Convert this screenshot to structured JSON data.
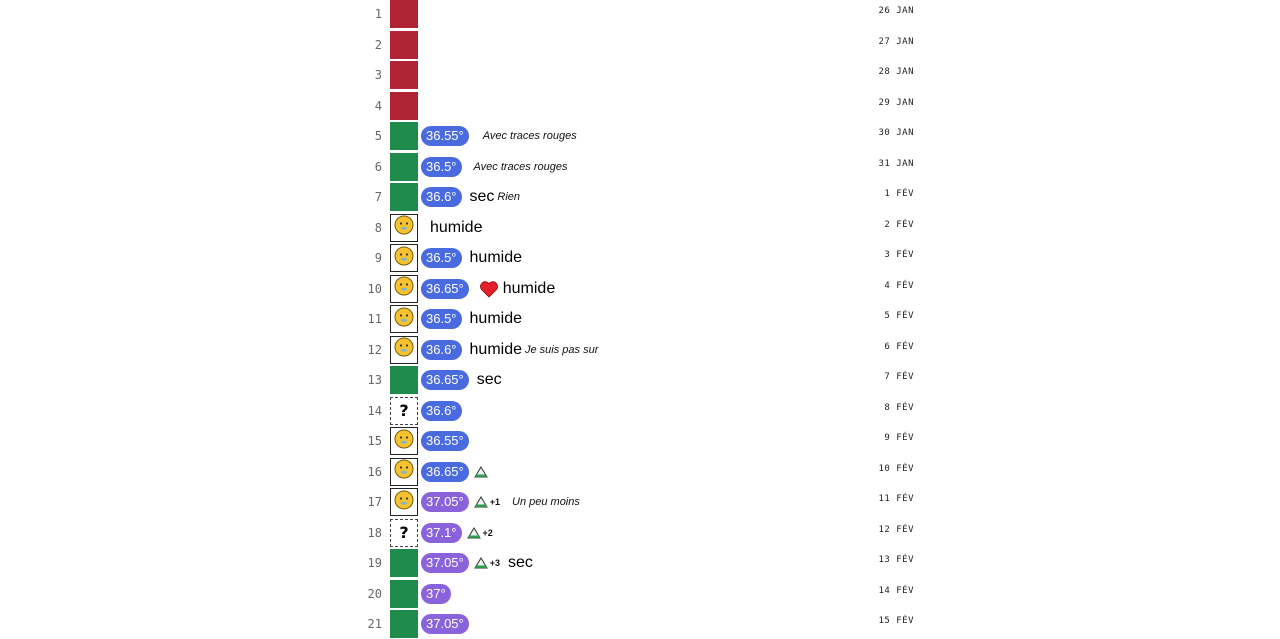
{
  "colors": {
    "period": "#b02436",
    "dry": "#1e8a4c",
    "temp_normal": "#4a6be0",
    "temp_high": "#8a63dc"
  },
  "rows": [
    {
      "num": "1",
      "box": "red",
      "date": "26 JAN"
    },
    {
      "num": "2",
      "box": "red",
      "date": "27 JAN"
    },
    {
      "num": "3",
      "box": "red",
      "date": "28 JAN"
    },
    {
      "num": "4",
      "box": "red",
      "date": "29 JAN"
    },
    {
      "num": "5",
      "box": "green",
      "temp": "36.55°",
      "temp_level": "normal",
      "note": "Avec traces rouges",
      "date": "30 JAN"
    },
    {
      "num": "6",
      "box": "green",
      "temp": "36.5°",
      "temp_level": "normal",
      "note": "Avec traces rouges",
      "date": "31 JAN"
    },
    {
      "num": "7",
      "box": "green",
      "temp": "36.6°",
      "temp_level": "normal",
      "obs": "sec",
      "note": "Rien",
      "date": "1 FÉV"
    },
    {
      "num": "8",
      "box": "face",
      "obs": "humide",
      "date": "2 FÉV"
    },
    {
      "num": "9",
      "box": "face",
      "temp": "36.5°",
      "temp_level": "normal",
      "obs": "humide",
      "date": "3 FÉV"
    },
    {
      "num": "10",
      "box": "face",
      "temp": "36.65°",
      "temp_level": "normal",
      "heart": true,
      "obs": "humide",
      "date": "4 FÉV"
    },
    {
      "num": "11",
      "box": "face",
      "temp": "36.5°",
      "temp_level": "normal",
      "obs": "humide",
      "date": "5 FÉV"
    },
    {
      "num": "12",
      "box": "face",
      "temp": "36.6°",
      "temp_level": "normal",
      "obs": "humide",
      "note": "Je suis pas sur",
      "date": "6 FÉV"
    },
    {
      "num": "13",
      "box": "green",
      "temp": "36.65°",
      "temp_level": "normal",
      "obs": "sec",
      "date": "7 FÉV"
    },
    {
      "num": "14",
      "box": "unknown",
      "box_text": "?",
      "temp": "36.6°",
      "temp_level": "normal",
      "date": "8 FÉV"
    },
    {
      "num": "15",
      "box": "face",
      "temp": "36.55°",
      "temp_level": "normal",
      "date": "9 FÉV"
    },
    {
      "num": "16",
      "box": "face",
      "temp": "36.65°",
      "temp_level": "normal",
      "peak": "",
      "date": "10 FÉV"
    },
    {
      "num": "17",
      "box": "face",
      "temp": "37.05°",
      "temp_level": "high",
      "peak": "+1",
      "note": "Un peu moins",
      "date": "11 FÉV"
    },
    {
      "num": "18",
      "box": "unknown",
      "box_text": "?",
      "temp": "37.1°",
      "temp_level": "high",
      "peak": "+2",
      "date": "12 FÉV"
    },
    {
      "num": "19",
      "box": "green",
      "temp": "37.05°",
      "temp_level": "high",
      "peak": "+3",
      "obs": "sec",
      "date": "13 FÉV"
    },
    {
      "num": "20",
      "box": "green",
      "temp": "37°",
      "temp_level": "high",
      "date": "14 FÉV"
    },
    {
      "num": "21",
      "box": "green",
      "temp": "37.05°",
      "temp_level": "high",
      "date": "15 FÉV"
    }
  ]
}
